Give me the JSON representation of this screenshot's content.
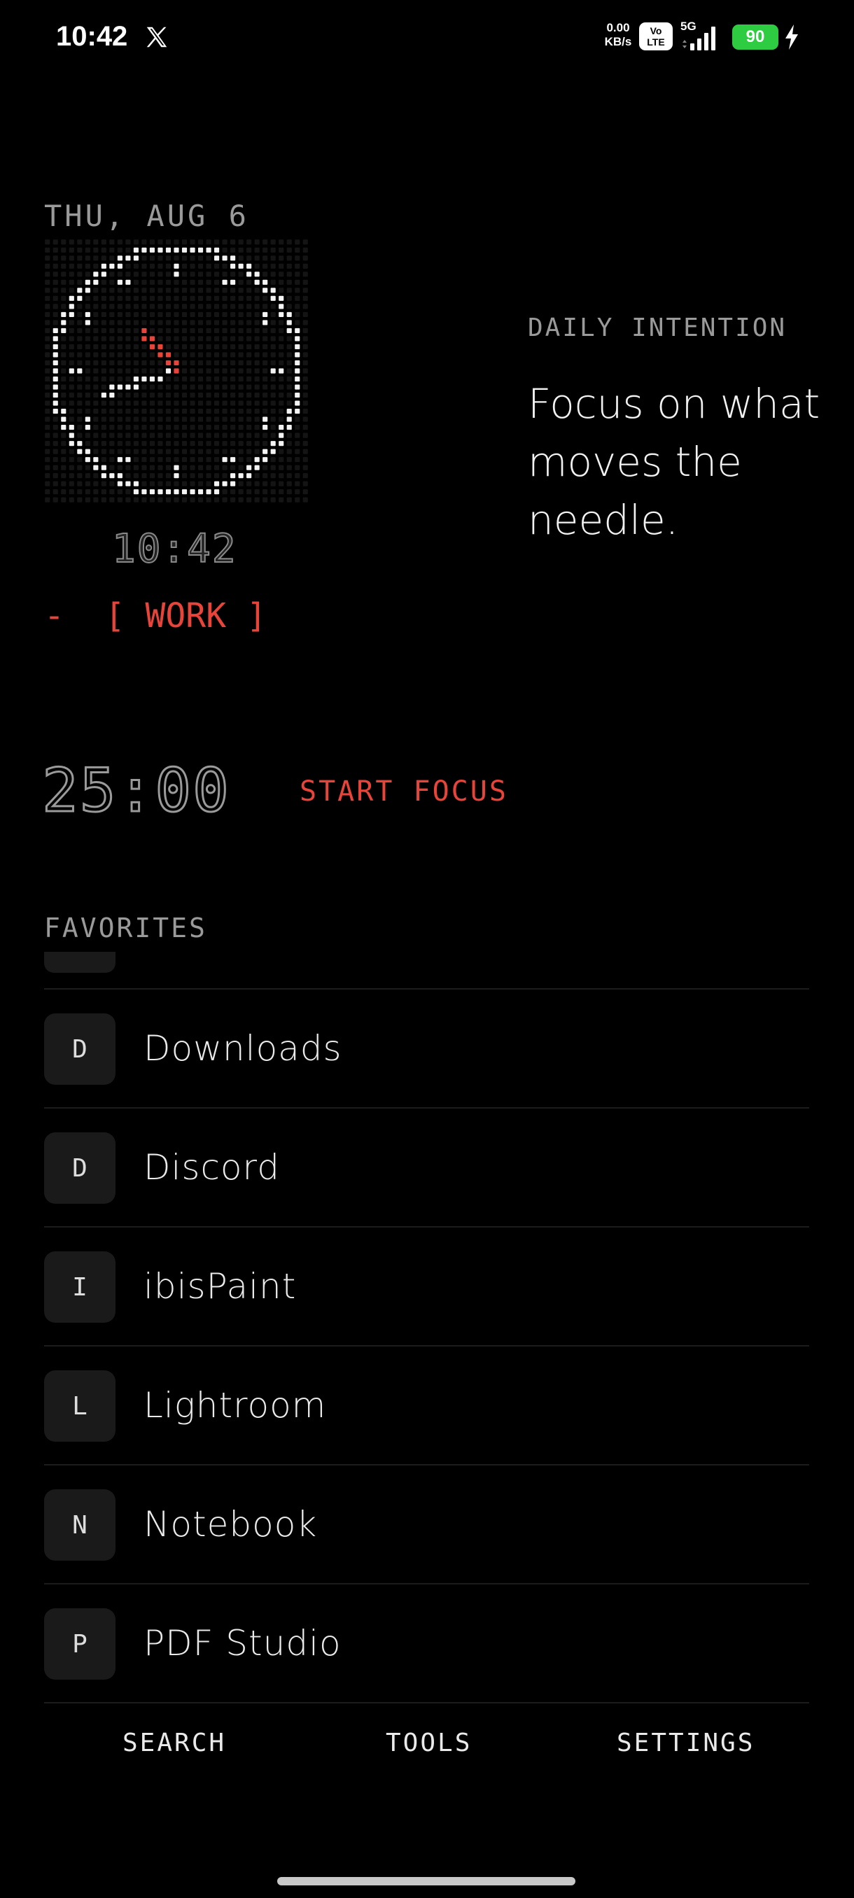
{
  "status_bar": {
    "time": "10:42",
    "net_speed_value": "0.00",
    "net_speed_unit": "KB/s",
    "volte_top": "Vo",
    "volte_bottom": "LTE",
    "network": "5G",
    "battery": "90",
    "icons": [
      "x-logo-icon",
      "signal-icon",
      "charging-bolt-icon"
    ]
  },
  "widget": {
    "date": "THU, AUG 6",
    "clock_time": "10:42",
    "mode": "-  [ WORK ]",
    "hand_color": "#e8443a"
  },
  "intention": {
    "label": "DAILY INTENTION",
    "text": "Focus on what moves the needle."
  },
  "focus": {
    "timer": "25:00",
    "start_label": "START FOCUS",
    "accent": "#e8443a"
  },
  "favorites": {
    "label": "FAVORITES",
    "items": [
      {
        "letter": "D",
        "name": "Downloads"
      },
      {
        "letter": "D",
        "name": "Discord"
      },
      {
        "letter": "I",
        "name": "ibisPaint"
      },
      {
        "letter": "L",
        "name": "Lightroom"
      },
      {
        "letter": "N",
        "name": "Notebook"
      },
      {
        "letter": "P",
        "name": "PDF Studio"
      }
    ]
  },
  "nav": {
    "search": "SEARCH",
    "tools": "TOOLS",
    "settings": "SETTINGS"
  }
}
